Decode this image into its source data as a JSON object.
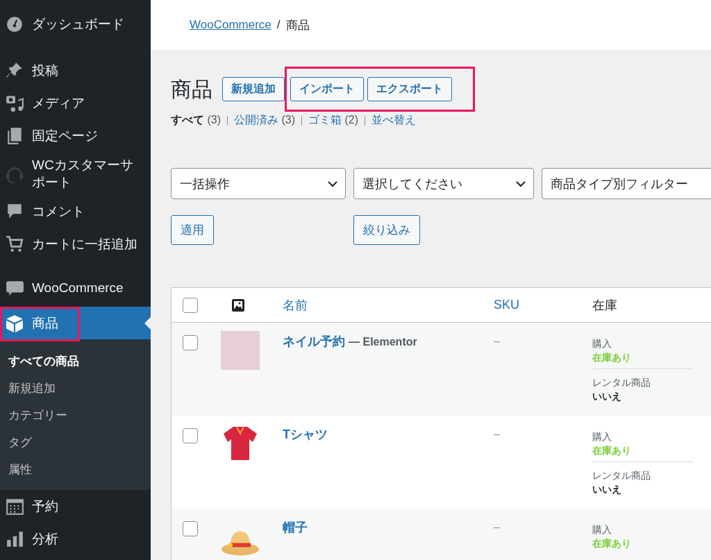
{
  "sidebar": {
    "groups": [
      [
        {
          "label": "ダッシュボード",
          "selected": false,
          "highlighted": false
        }
      ],
      [
        {
          "label": "投稿",
          "selected": false,
          "highlighted": false
        },
        {
          "label": "メディア",
          "selected": false,
          "highlighted": false
        },
        {
          "label": "固定ページ",
          "selected": false,
          "highlighted": false
        },
        {
          "label": "WCカスタマーサポート",
          "selected": false,
          "highlighted": false
        },
        {
          "label": "コメント",
          "selected": false,
          "highlighted": false
        },
        {
          "label": "カートに一括追加",
          "selected": false,
          "highlighted": false
        }
      ],
      [
        {
          "label": "WooCommerce",
          "selected": false,
          "highlighted": false
        },
        {
          "label": "商品",
          "selected": true,
          "highlighted": true,
          "children": [
            {
              "label": "すべての商品",
              "selected": true
            },
            {
              "label": "新規追加",
              "selected": false
            },
            {
              "label": "カテゴリー",
              "selected": false
            },
            {
              "label": "タグ",
              "selected": false
            },
            {
              "label": "属性",
              "selected": false
            }
          ]
        },
        {
          "label": "予約",
          "selected": false,
          "highlighted": false
        },
        {
          "label": "分析",
          "selected": false,
          "highlighted": false
        }
      ]
    ]
  },
  "breadcrumb": {
    "link": "WooCommerce",
    "separator": "/",
    "current": "商品"
  },
  "page_title": "商品",
  "title_buttons": [
    {
      "label": "新規追加",
      "highlighted": false
    },
    {
      "label": "インポート",
      "highlighted": true
    },
    {
      "label": "エクスポート",
      "highlighted": true
    }
  ],
  "views": [
    {
      "label": "すべて",
      "count": "(3)",
      "selected": true
    },
    {
      "label": "公開済み",
      "count": "(3)",
      "selected": false
    },
    {
      "label": "ゴミ箱",
      "count": "(2)",
      "selected": false
    },
    {
      "label": "並べ替え",
      "selected": false
    }
  ],
  "filters": [
    {
      "value": "一括操作"
    },
    {
      "value": "選択してください"
    },
    {
      "value": "商品タイプ別フィルター"
    }
  ],
  "apply_button": "適用",
  "filter_button": "絞り込み",
  "table": {
    "columns": [
      {
        "kind": "check",
        "checked": false
      },
      {
        "kind": "image"
      },
      {
        "kind": "sort",
        "label": "名前"
      },
      {
        "kind": "sort",
        "label": "SKU"
      },
      {
        "kind": "plain",
        "label": "在庫"
      }
    ],
    "rows": [
      {
        "checked": false,
        "kind": "photo",
        "name": "ネイル予約",
        "suffix": "— Elementor",
        "sku": "–",
        "stock": [
          {
            "label": "購入",
            "value": "在庫あり",
            "kind": "instock"
          },
          {
            "label": "レンタル商品",
            "value": "いいえ",
            "kind": "plain"
          }
        ]
      },
      {
        "checked": false,
        "kind": "shirt",
        "name": "Tシャツ",
        "sku": "–",
        "stock": [
          {
            "label": "購入",
            "value": "在庫あり",
            "kind": "instock"
          },
          {
            "label": "レンタル商品",
            "value": "いいえ",
            "kind": "plain"
          }
        ]
      },
      {
        "checked": false,
        "kind": "hat",
        "name": "帽子",
        "sku": "–",
        "stock": [
          {
            "label": "購入",
            "value": "在庫あり",
            "kind": "instock"
          }
        ]
      }
    ]
  }
}
